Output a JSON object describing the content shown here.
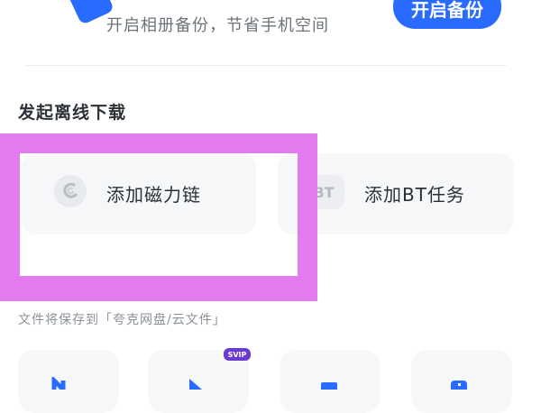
{
  "banner": {
    "text": "开启相册备份，节省手机空间",
    "button_label": "开启备份"
  },
  "offline": {
    "section_title": "发起离线下载",
    "magnet_label": "添加磁力链",
    "bt_label": "添加BT任务",
    "bt_icon_text": "BT",
    "save_path": "文件将保存到「夸克网盘/云文件」"
  },
  "bottom": {
    "svip_badge": "SVIP"
  },
  "colors": {
    "accent": "#2a6bff",
    "highlight": "#e27af0"
  }
}
